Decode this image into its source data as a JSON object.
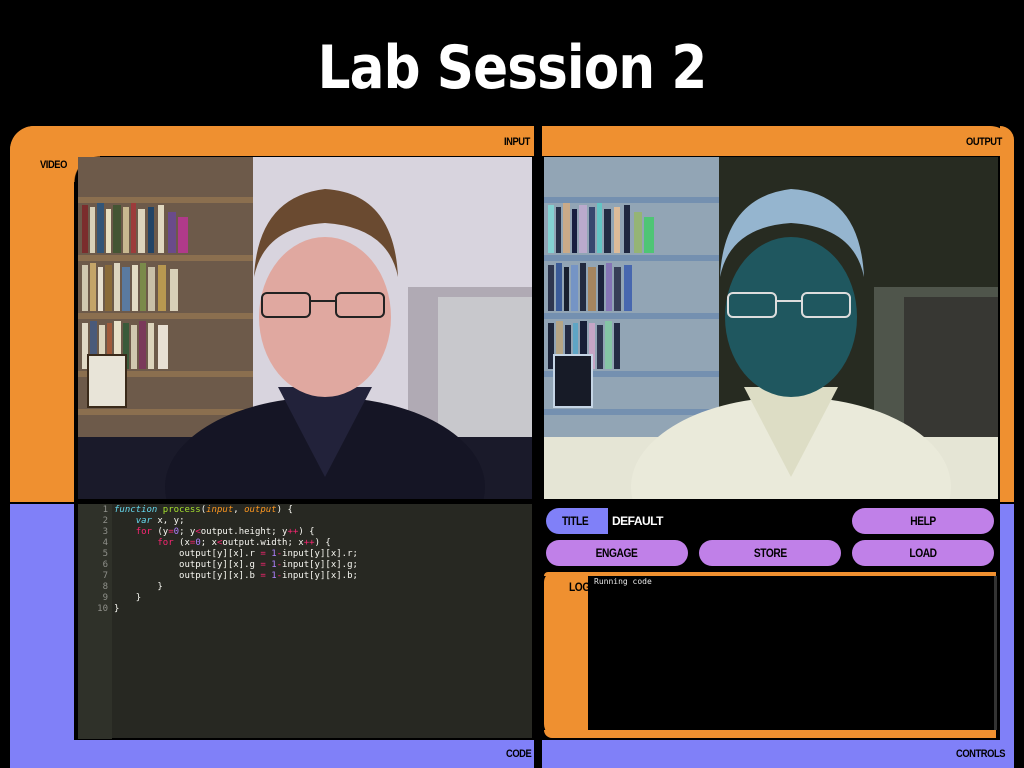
{
  "slide": {
    "title": "Lab Session 2"
  },
  "labels": {
    "input": "INPUT",
    "output": "OUTPUT",
    "video": "VIDEO",
    "code": "CODE",
    "controls": "CONTROLS",
    "log": "LOG"
  },
  "controls": {
    "title_label": "TITLE",
    "title_value": "DEFAULT",
    "help": "HELP",
    "engage": "ENGAGE",
    "store": "STORE",
    "load": "LOAD"
  },
  "log": {
    "text": "Running code"
  },
  "code": {
    "line_numbers": [
      "1",
      "2",
      "3",
      "4",
      "5",
      "6",
      "7",
      "8",
      "9",
      "10"
    ],
    "lines": [
      "function process(input, output) {",
      "    var x, y;",
      "    for (y=0; y<output.height; y++) {",
      "        for (x=0; x<output.width; x++) {",
      "            output[y][x].r = 1-input[y][x].r;",
      "            output[y][x].g = 1-input[y][x].g;",
      "            output[y][x].b = 1-input[y][x].b;",
      "        }",
      "    }",
      "}"
    ]
  },
  "colors": {
    "lcars_orange": "#ef9030",
    "lcars_violet": "#8080f8",
    "button_purple": "#c080e8",
    "background": "#000000"
  }
}
